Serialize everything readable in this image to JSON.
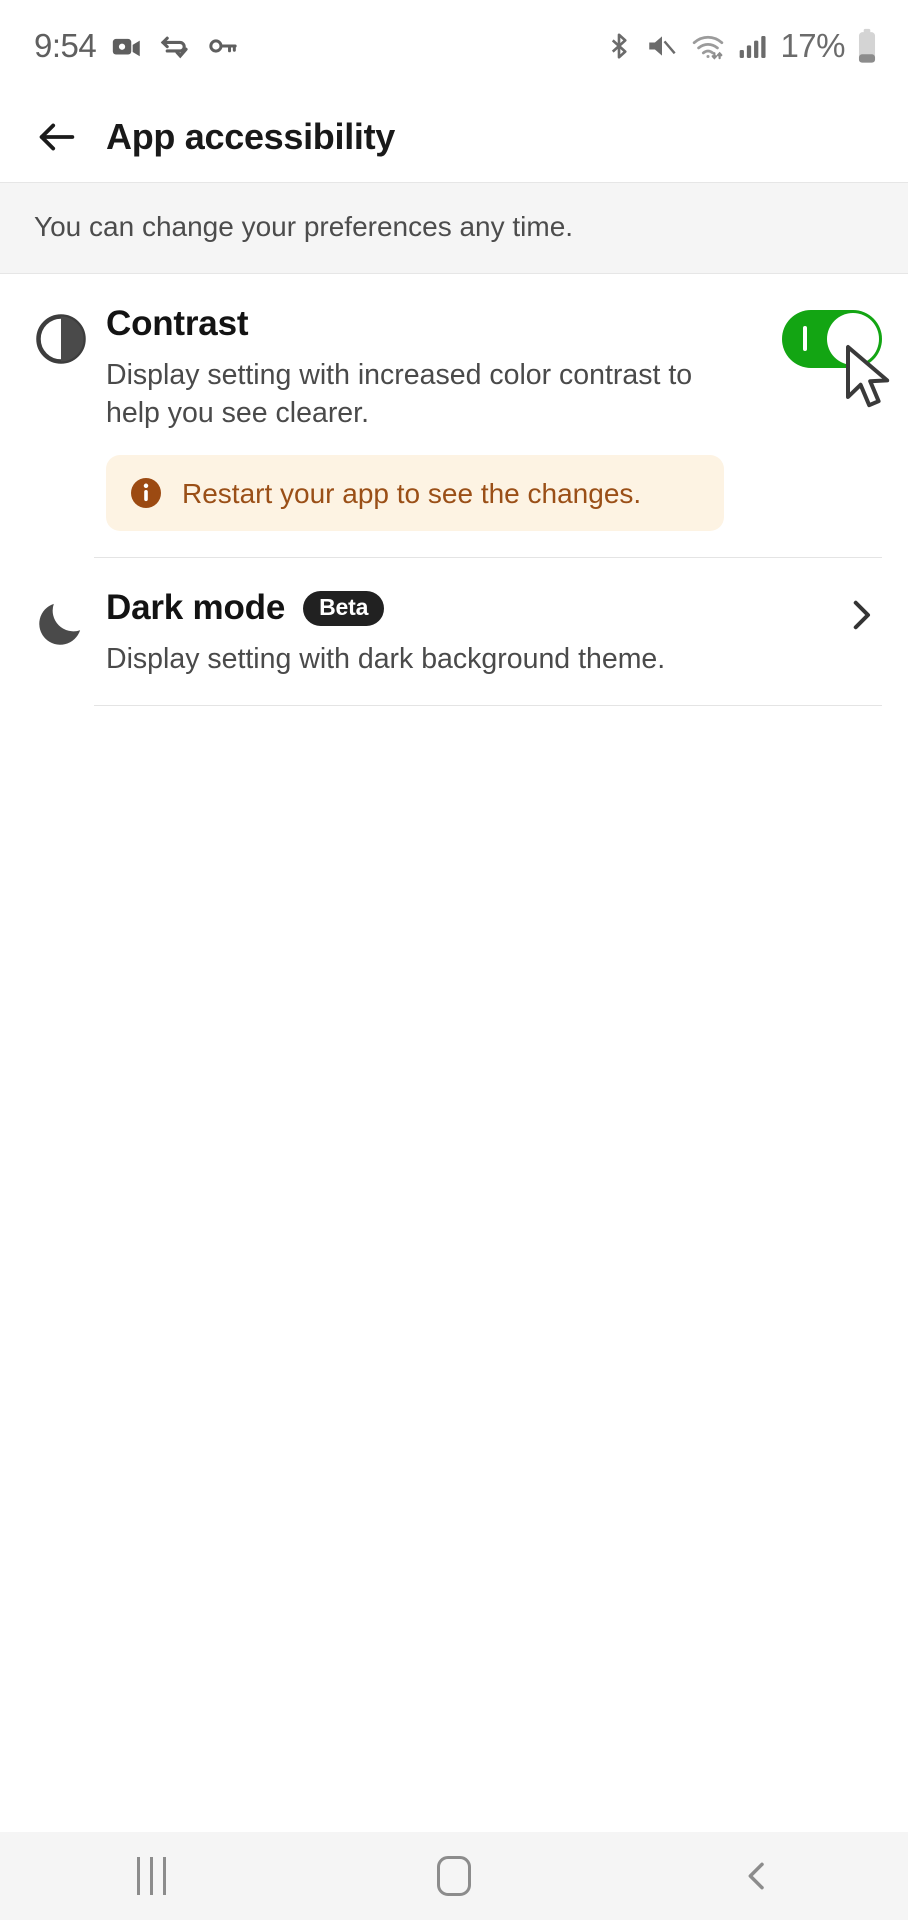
{
  "statusbar": {
    "time": "9:54",
    "battery_percent": "17%",
    "left_icons": [
      "video-camera-icon",
      "vpn-check-icon",
      "key-icon"
    ],
    "right_icons": [
      "bluetooth-icon",
      "volume-muted-icon",
      "wifi-icon",
      "cellular-signal-icon",
      "battery-low-icon"
    ]
  },
  "appbar": {
    "back_icon": "arrow-left-icon",
    "title": "App accessibility"
  },
  "notice": {
    "text": "You can change your preferences any time."
  },
  "settings": {
    "items": [
      {
        "id": "contrast",
        "icon": "contrast-circle-icon",
        "title": "Contrast",
        "description": "Display setting with increased color contrast to help you see clearer.",
        "control": "toggle",
        "toggle_on": true,
        "alert": {
          "icon": "info-circle-icon",
          "text": "Restart your app to see the changes."
        }
      },
      {
        "id": "dark-mode",
        "icon": "moon-icon",
        "title": "Dark mode",
        "badge": "Beta",
        "description": "Display setting with dark background theme.",
        "control": "chevron",
        "chevron_icon": "chevron-right-icon"
      }
    ]
  },
  "navbar": {
    "recents_icon": "recents-icon",
    "home_icon": "home-icon",
    "back_icon": "nav-back-icon"
  },
  "colors": {
    "toggle_on": "#13a513",
    "alert_bg": "#fdf3e3",
    "alert_fg": "#9a4f17",
    "badge_bg": "#212121",
    "banner_bg": "#f5f5f5"
  },
  "cursor": {
    "name": "mouse-pointer"
  }
}
